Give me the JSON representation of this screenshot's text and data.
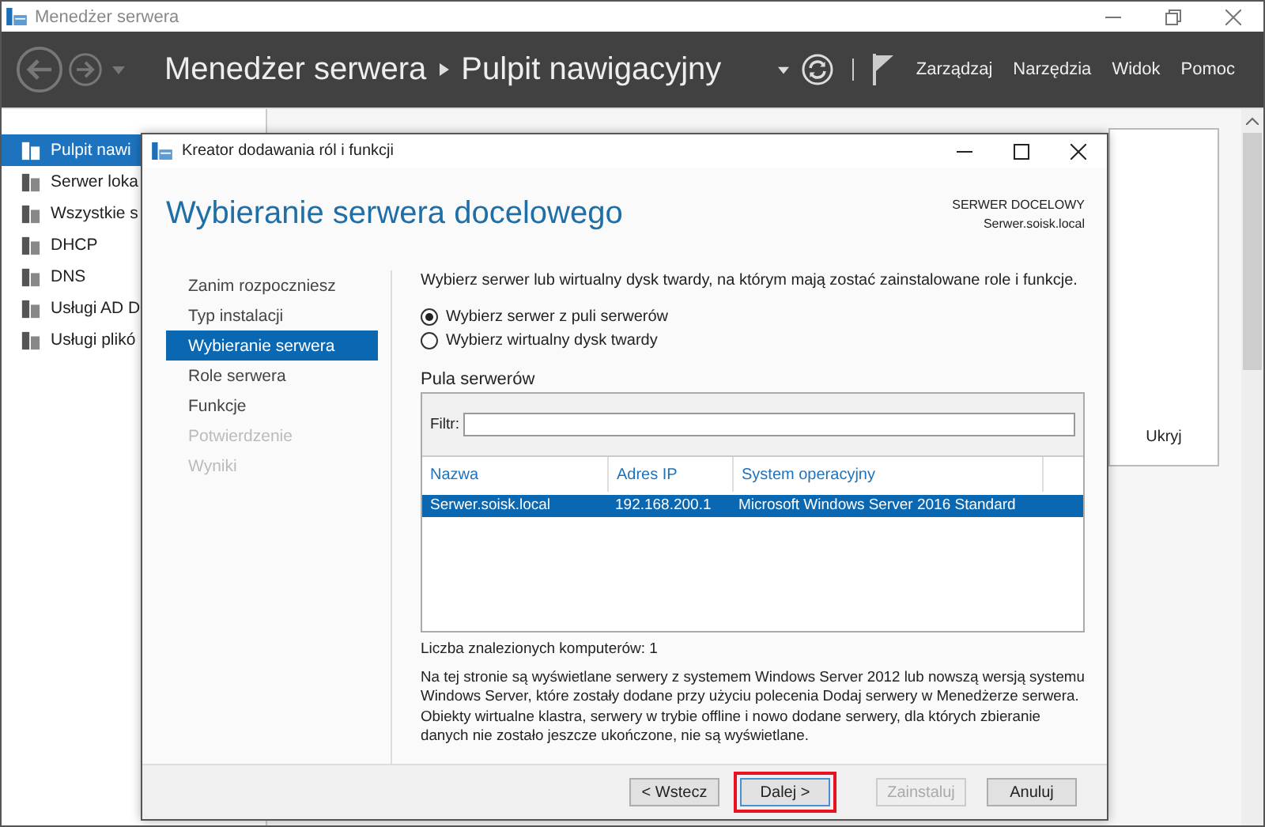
{
  "window": {
    "title": "Menedżer serwera"
  },
  "header": {
    "breadcrumb": [
      "Menedżer serwera",
      "Pulpit nawigacyjny"
    ],
    "menu": [
      "Zarządzaj",
      "Narzędzia",
      "Widok",
      "Pomoc"
    ]
  },
  "sidebar": {
    "items": [
      {
        "label": "Pulpit nawi",
        "selected": true
      },
      {
        "label": "Serwer loka",
        "selected": false
      },
      {
        "label": "Wszystkie s",
        "selected": false
      },
      {
        "label": "DHCP",
        "selected": false
      },
      {
        "label": "DNS",
        "selected": false
      },
      {
        "label": "Usługi AD D",
        "selected": false
      },
      {
        "label": "Usługi plikó",
        "selected": false
      }
    ]
  },
  "panel": {
    "link": "Ukryj"
  },
  "dialog": {
    "title": "Kreator dodawania ról i funkcji",
    "heading": "Wybieranie serwera docelowego",
    "destination_label": "SERWER DOCELOWY",
    "destination_server": "Serwer.soisk.local",
    "steps": [
      {
        "label": "Zanim rozpoczniesz",
        "selected": false,
        "disabled": false
      },
      {
        "label": "Typ instalacji",
        "selected": false,
        "disabled": false
      },
      {
        "label": "Wybieranie serwera",
        "selected": true,
        "disabled": false
      },
      {
        "label": "Role serwera",
        "selected": false,
        "disabled": false
      },
      {
        "label": "Funkcje",
        "selected": false,
        "disabled": false
      },
      {
        "label": "Potwierdzenie",
        "selected": false,
        "disabled": true
      },
      {
        "label": "Wyniki",
        "selected": false,
        "disabled": true
      }
    ],
    "instruction": "Wybierz serwer lub wirtualny dysk twardy, na którym mają zostać zainstalowane role i funkcje.",
    "options": [
      {
        "label": "Wybierz serwer z puli serwerów",
        "selected": true
      },
      {
        "label": "Wybierz wirtualny dysk twardy",
        "selected": false
      }
    ],
    "pool": {
      "title": "Pula serwerów",
      "filter_label": "Filtr:",
      "columns": [
        "Nazwa",
        "Adres IP",
        "System operacyjny"
      ],
      "rows": [
        {
          "cells": [
            "Serwer.soisk.local",
            "192.168.200.1",
            "Microsoft Windows Server 2016 Standard"
          ],
          "selected": true
        }
      ]
    },
    "count": "Liczba znalezionych komputerów: 1",
    "note": "Na tej stronie są wyświetlane serwery z systemem Windows Server 2012 lub nowszą wersją systemu Windows Server, które zostały dodane przy użyciu polecenia Dodaj serwery w Menedżerze serwera. Obiekty wirtualne klastra, serwery w trybie offline i nowo dodane serwery, dla których zbieranie danych nie zostało jeszcze ukończone, nie są wyświetlane.",
    "buttons": [
      {
        "label": "< Wstecz",
        "disabled": false,
        "highlighted": false
      },
      {
        "label": "Dalej >",
        "disabled": false,
        "highlighted": true
      },
      {
        "label": "Zainstaluj",
        "disabled": true,
        "highlighted": false
      },
      {
        "label": "Anuluj",
        "disabled": false,
        "highlighted": false
      }
    ]
  }
}
